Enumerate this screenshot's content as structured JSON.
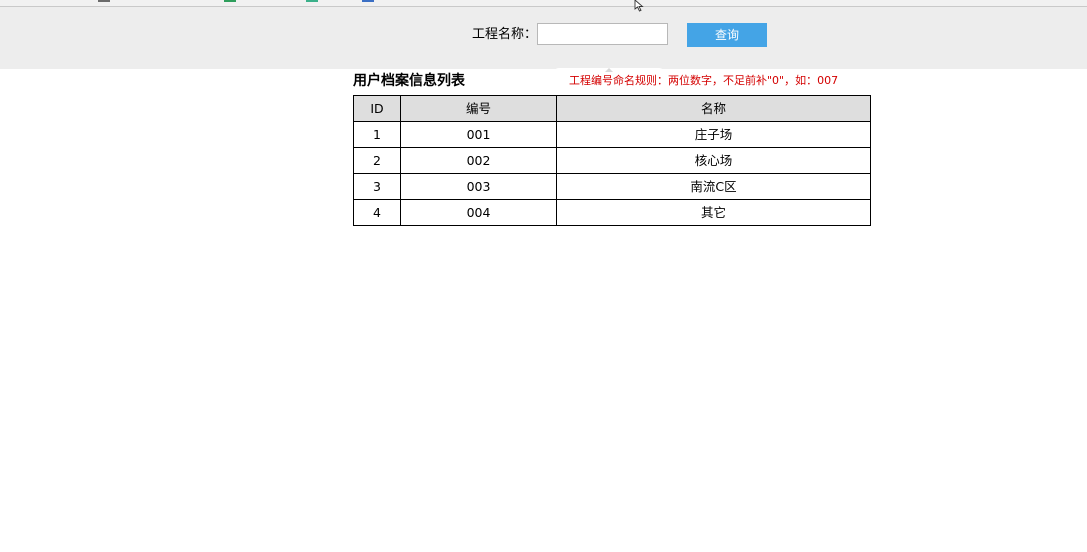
{
  "query": {
    "label": "工程名称：",
    "input_value": "",
    "input_placeholder": "",
    "button_label": "查询"
  },
  "list": {
    "title": "用户档案信息列表",
    "rule_note": "工程编号命名规则：两位数字，不足前补\"0\"，如：007",
    "columns": [
      "ID",
      "编号",
      "名称"
    ],
    "rows": [
      {
        "id": "1",
        "code": "001",
        "name": "庄子场"
      },
      {
        "id": "2",
        "code": "002",
        "name": "核心场"
      },
      {
        "id": "3",
        "code": "003",
        "name": "南流C区"
      },
      {
        "id": "4",
        "code": "004",
        "name": "其它"
      }
    ]
  },
  "colors": {
    "accent_button": "#44a4e6",
    "rule_note_text": "#d40000",
    "header_cell_bg": "#dedede",
    "toolbar_bg": "#ededed"
  }
}
